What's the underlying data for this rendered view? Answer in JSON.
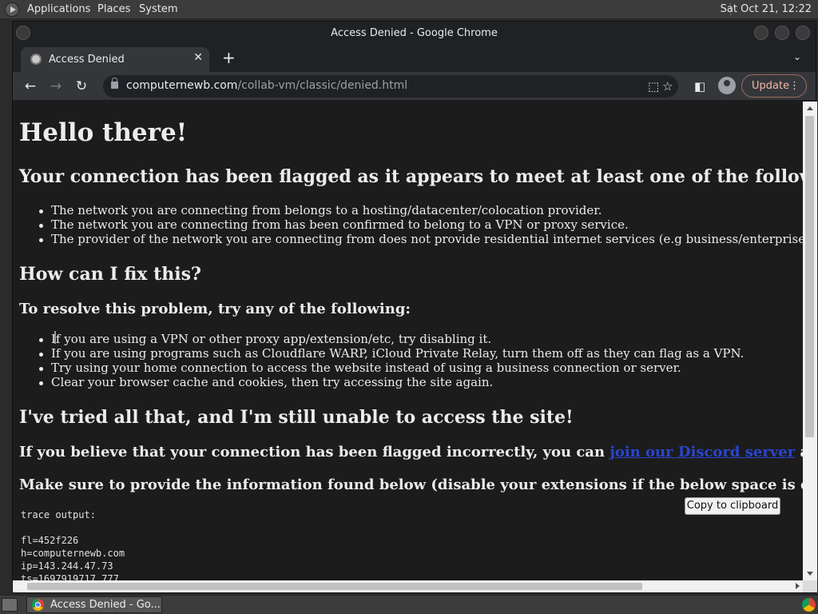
{
  "top_panel": {
    "menus": [
      "Applications",
      "Places",
      "System"
    ],
    "clock": "Sat Oct 21, 12:22"
  },
  "window": {
    "title": "Access Denied - Google Chrome"
  },
  "tab": {
    "title": "Access Denied",
    "close_glyph": "✕"
  },
  "toolbar": {
    "new_tab_glyph": "+",
    "url_host": "computernewb.com",
    "url_path": "/collab-vm/classic/denied.html",
    "update_label": "Update"
  },
  "page": {
    "heading": "Hello there!",
    "criteria_heading": "Your connection has been flagged as it appears to meet at least one of the following criteria:",
    "criteria": [
      "The network you are connecting from belongs to a hosting/datacenter/colocation provider.",
      "The network you are connecting from has been confirmed to belong to a VPN or proxy service.",
      "The provider of the network you are connecting from does not provide residential internet services (e.g business/enterprise-only networks)."
    ],
    "fix_heading": "How can I fix this?",
    "resolve_intro": "To resolve this problem, try any of the following:",
    "fixes": [
      "If you are using a VPN or other proxy app/extension/etc, try disabling it.",
      "If you are using programs such as Cloudflare WARP, iCloud Private Relay, turn them off as they can flag as a VPN.",
      "Try using your home connection to access the website instead of using a business connection or server.",
      "Clear your browser cache and cookies, then try accessing the site again."
    ],
    "tried_heading": "I've tried all that, and I'm still unable to access the site!",
    "believe_prefix": "If you believe that your connection has been flagged incorrectly, you can ",
    "discord_link": "join our Discord server",
    "believe_suffix": " and open a ticket.",
    "provide_info": "Make sure to provide the information found below (disable your extensions if the below space is empty):",
    "copy_button": "Copy to clipboard",
    "trace_label": "trace output:",
    "trace_lines": [
      "fl=452f226",
      "h=computernewb.com",
      "ip=143.244.47.73",
      "ts=1697919717.777"
    ]
  },
  "taskbar": {
    "task_label": "Access Denied - Go..."
  },
  "colors": {
    "page_bg": "#1c1c1c",
    "chrome_bg": "#202124",
    "toolbar_bg": "#35363a",
    "link": "#2a45d0",
    "update_accent": "#f2b8a8"
  },
  "icons": [
    "applications-logo",
    "tab-favicon",
    "back-arrow",
    "forward-arrow",
    "reload",
    "lock",
    "share",
    "bookmark-star",
    "side-panel",
    "profile-avatar",
    "kebab-menu",
    "tab-search-chevron",
    "chrome-logo"
  ]
}
